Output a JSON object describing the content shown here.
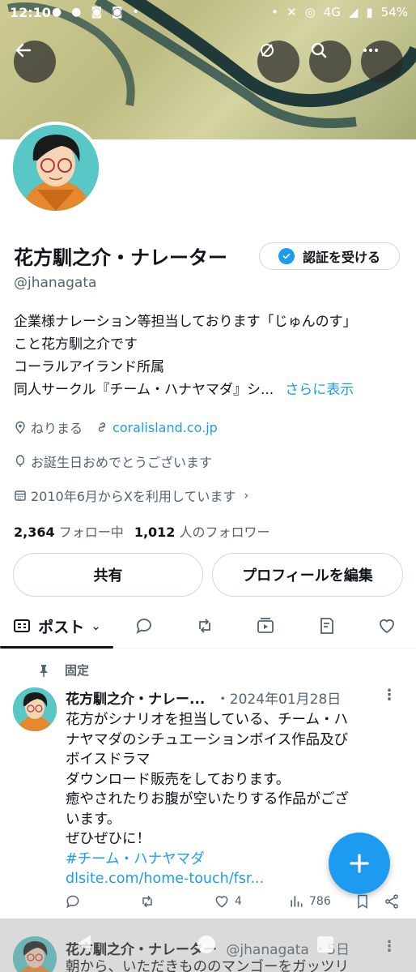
{
  "status_bar": {
    "time": "12:10",
    "network": "4G",
    "battery": "54%",
    "left_icons": [
      "facebook-icon",
      "facebook-icon",
      "discord-icon",
      "discord-icon",
      "dot-icon"
    ],
    "right_icons": [
      "dot-icon",
      "mute-icon",
      "hotspot-icon",
      "signal-icon",
      "battery-icon"
    ]
  },
  "header": {
    "buttons": [
      "back-icon",
      "no-sync-icon",
      "search-icon",
      "more-icon"
    ]
  },
  "profile": {
    "name": "花方馴之介・ナレーター",
    "verify_label": "認証を受ける",
    "handle": "@jhanagata",
    "bio": [
      "企業様ナレーション等担当しております「じゅんのす」",
      "こと花方馴之介です",
      "コーラルアイランド所属",
      "同人サークル『チーム・ハナヤマダ』シ..."
    ],
    "show_more": "さらに表示",
    "location": "ねりまる",
    "website": "coralisland.co.jp",
    "birthday": "お誕生日おめでとうございます",
    "joined": "2010年6月からXを利用しています",
    "following_count": "2,364",
    "following_label": "フォロー中",
    "followers_count": "1,012",
    "followers_label": "人のフォロワー",
    "share_label": "共有",
    "edit_label": "プロフィールを編集"
  },
  "tabs": {
    "posts_label": "ポスト",
    "icons": [
      "posts-icon",
      "replies-icon",
      "reposts-icon",
      "videos-icon",
      "articles-icon",
      "likes-icon"
    ]
  },
  "pinned_post": {
    "pinned_label": "固定",
    "author": "花方馴之介・ナレー...",
    "date": "・2024年01月28日",
    "text": [
      "花方がシナリオを担当している、チーム・ハ",
      "ナヤマダのシチュエーションボイス作品及び",
      "ボイスドラマ",
      "ダウンロード販売をしております。",
      "癒やされたりお腹が空いたりする作品がござ",
      "います。",
      "ぜひぜひに！"
    ],
    "hashtag": "#チーム・ハナヤマダ",
    "link": "dlsite.com/home-touch/fsr...",
    "likes": "4",
    "views": "786"
  },
  "next_post": {
    "author": "花方馴之介・ナレーター",
    "handle": "@jhanagata",
    "date": "・5日",
    "text": "朝から、いただきもののマンゴーをガッツリ"
  },
  "colors": {
    "accent": "#1d9bf0",
    "text": "#0f1419",
    "muted": "#536471"
  }
}
